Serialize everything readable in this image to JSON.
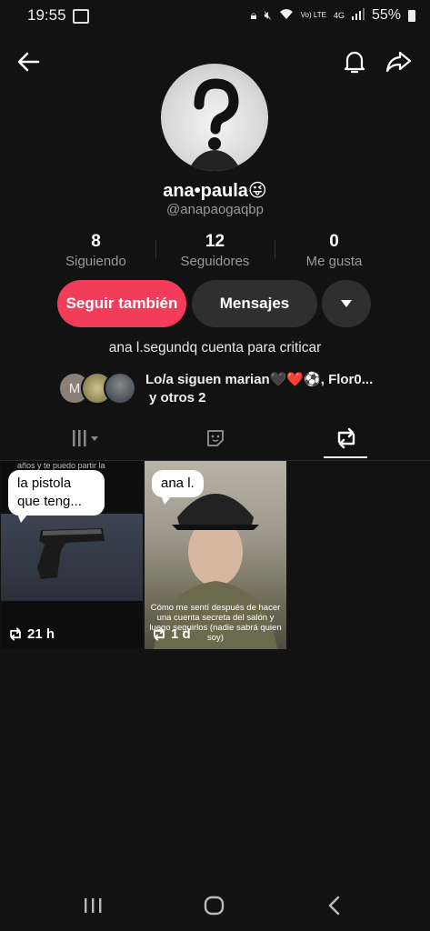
{
  "status_bar": {
    "time": "19:55",
    "battery": "55%",
    "net": "4G",
    "lte": "Vo) LTE"
  },
  "profile": {
    "name": "ana•paula😜",
    "handle": "@anapaogaqbp",
    "stats": [
      {
        "value": "8",
        "label": "Siguiendo"
      },
      {
        "value": "12",
        "label": "Seguidores"
      },
      {
        "value": "0",
        "label": "Me gusta"
      }
    ],
    "buttons": {
      "follow": "Seguir también",
      "message": "Mensajes"
    },
    "bio": "ana l.segundq  cuenta para criticar",
    "mutual": {
      "avatar_letter": "M",
      "line1": "Lo/a siguen marian🖤❤️⚽, Flor0...",
      "line2": "y otros 2"
    }
  },
  "posts": [
    {
      "top_text": "años y te puedo partir la",
      "bubble": "la pistola\nque teng...",
      "count": "21 h"
    },
    {
      "bubble": "ana l.",
      "caption": "Cómo me sentí después de hacer una cuenta secreta del salón y luego seguirlos (nadie sabrá quien soy)",
      "count": "1 d"
    }
  ],
  "colors": {
    "background": "#121212",
    "accent": "#f23c5a",
    "button": "#2f2f2f"
  }
}
